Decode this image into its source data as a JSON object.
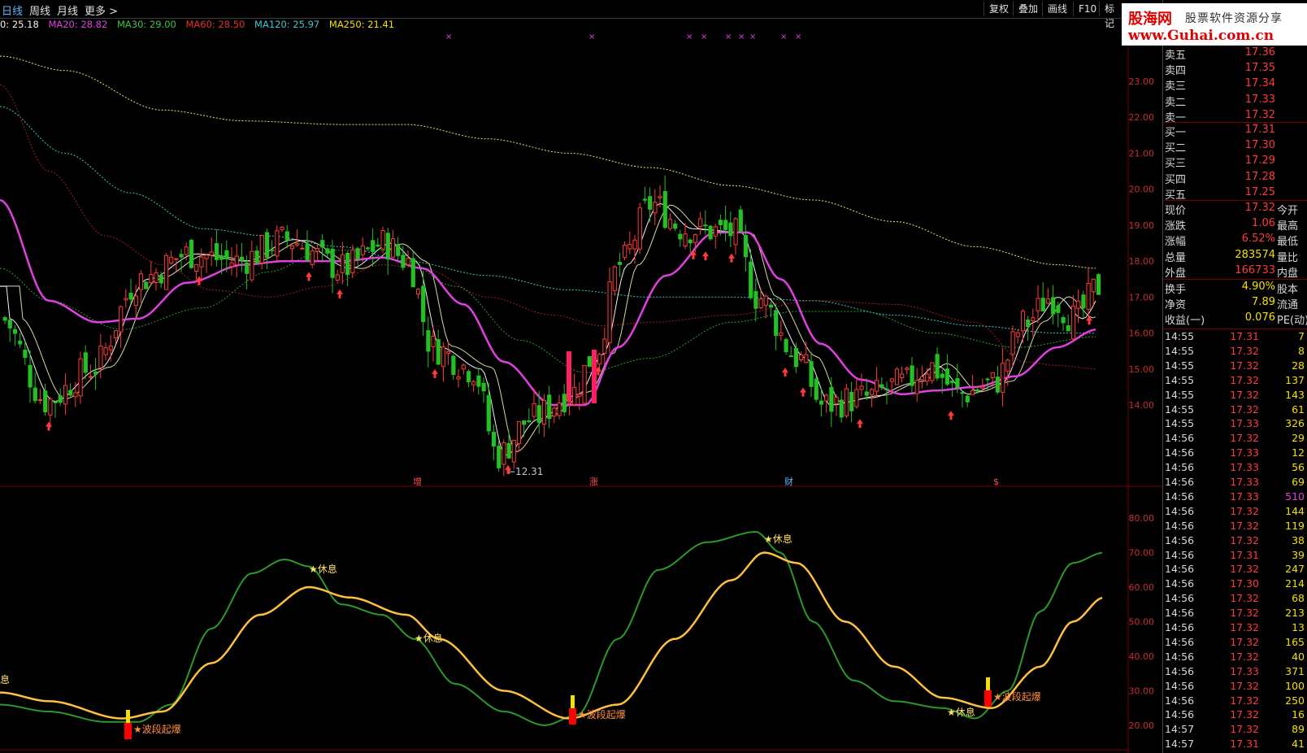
{
  "toolbar": {
    "tabs": [
      "日线",
      "周线",
      "月线",
      "更多 >"
    ],
    "buttons": [
      "复权",
      "叠加",
      "画线",
      "F10",
      "标记"
    ]
  },
  "ma_bar": [
    {
      "label": "0: 25.18",
      "color": "#f2f2f2"
    },
    {
      "label": "MA20: 28.82",
      "color": "#e040e0"
    },
    {
      "label": "MA30: 29.00",
      "color": "#40c040"
    },
    {
      "label": "MA60: 28.50",
      "color": "#e03030"
    },
    {
      "label": "MA120: 25.97",
      "color": "#40c8c8"
    },
    {
      "label": "MA250: 21.41",
      "color": "#f2e000"
    }
  ],
  "logo": {
    "brand": "股海网",
    "tagline": "股票软件资源分享",
    "url": "www.Guhai.com.cn"
  },
  "price_axis": [
    "23.00",
    "22.00",
    "21.00",
    "20.00",
    "19.00",
    "18.00",
    "17.00",
    "16.00",
    "15.00",
    "14.00"
  ],
  "indicator_axis": [
    "80.00",
    "70.00",
    "60.00",
    "50.00",
    "40.00",
    "30.00",
    "20.00"
  ],
  "chart_labels": {
    "low_price": "12.31",
    "event_marks": [
      "增",
      "涨",
      "财",
      "$"
    ],
    "rest_marks": [
      "★休息",
      "★休息",
      "★休息",
      "★休息"
    ],
    "burst_marks": [
      "★波段起爆",
      "★波段起爆",
      "★波段起爆"
    ],
    "edge_label": "息"
  },
  "order_book": {
    "asks": [
      {
        "label": "卖五",
        "price": "17.36"
      },
      {
        "label": "卖四",
        "price": "17.35"
      },
      {
        "label": "卖三",
        "price": "17.34"
      },
      {
        "label": "卖二",
        "price": "17.33"
      },
      {
        "label": "卖一",
        "price": "17.32"
      }
    ],
    "bids": [
      {
        "label": "买一",
        "price": "17.31"
      },
      {
        "label": "买二",
        "price": "17.30"
      },
      {
        "label": "买三",
        "price": "17.29"
      },
      {
        "label": "买四",
        "price": "17.28"
      },
      {
        "label": "买五",
        "price": "17.25"
      }
    ]
  },
  "stats": [
    {
      "label": "现价",
      "value": "17.32",
      "right": "今开"
    },
    {
      "label": "涨跌",
      "value": "1.06",
      "right": "最高"
    },
    {
      "label": "涨幅",
      "value": "6.52%",
      "right": "最低"
    },
    {
      "label": "总量",
      "value": "283574",
      "right": "量比"
    },
    {
      "label": "外盘",
      "value": "166733",
      "right": "内盘"
    },
    {
      "label": "换手",
      "value": "4.90%",
      "right": "股本"
    },
    {
      "label": "净资",
      "value": "7.89",
      "right": "流通"
    },
    {
      "label": "收益(一)",
      "value": "0.076",
      "right": "PE(动)"
    }
  ],
  "ticks": [
    {
      "time": "14:55",
      "price": "17.31",
      "vol": "7"
    },
    {
      "time": "14:55",
      "price": "17.32",
      "vol": "8"
    },
    {
      "time": "14:55",
      "price": "17.32",
      "vol": "28"
    },
    {
      "time": "14:55",
      "price": "17.32",
      "vol": "137"
    },
    {
      "time": "14:55",
      "price": "17.32",
      "vol": "143"
    },
    {
      "time": "14:55",
      "price": "17.32",
      "vol": "61"
    },
    {
      "time": "14:55",
      "price": "17.33",
      "vol": "326"
    },
    {
      "time": "14:56",
      "price": "17.32",
      "vol": "29"
    },
    {
      "time": "14:56",
      "price": "17.33",
      "vol": "12"
    },
    {
      "time": "14:56",
      "price": "17.33",
      "vol": "56"
    },
    {
      "time": "14:56",
      "price": "17.33",
      "vol": "69"
    },
    {
      "time": "14:56",
      "price": "17.33",
      "vol": "510"
    },
    {
      "time": "14:56",
      "price": "17.32",
      "vol": "144"
    },
    {
      "time": "14:56",
      "price": "17.32",
      "vol": "119"
    },
    {
      "time": "14:56",
      "price": "17.32",
      "vol": "38"
    },
    {
      "time": "14:56",
      "price": "17.31",
      "vol": "39"
    },
    {
      "time": "14:56",
      "price": "17.32",
      "vol": "247"
    },
    {
      "time": "14:56",
      "price": "17.30",
      "vol": "214"
    },
    {
      "time": "14:56",
      "price": "17.32",
      "vol": "68"
    },
    {
      "time": "14:56",
      "price": "17.32",
      "vol": "213"
    },
    {
      "time": "14:56",
      "price": "17.32",
      "vol": "13"
    },
    {
      "time": "14:56",
      "price": "17.32",
      "vol": "165"
    },
    {
      "time": "14:56",
      "price": "17.32",
      "vol": "40"
    },
    {
      "time": "14:56",
      "price": "17.33",
      "vol": "371"
    },
    {
      "time": "14:56",
      "price": "17.32",
      "vol": "100"
    },
    {
      "time": "14:56",
      "price": "17.32",
      "vol": "250"
    },
    {
      "time": "14:56",
      "price": "17.32",
      "vol": "16"
    },
    {
      "time": "14:57",
      "price": "17.32",
      "vol": "89"
    },
    {
      "time": "14:57",
      "price": "17.31",
      "vol": "41"
    }
  ],
  "colors": {
    "up": "#ff3a3a",
    "down": "#22c022",
    "ma20": "#e040e0",
    "osc_fast": "#2a9a2a",
    "osc_slow": "#ffc040"
  }
}
